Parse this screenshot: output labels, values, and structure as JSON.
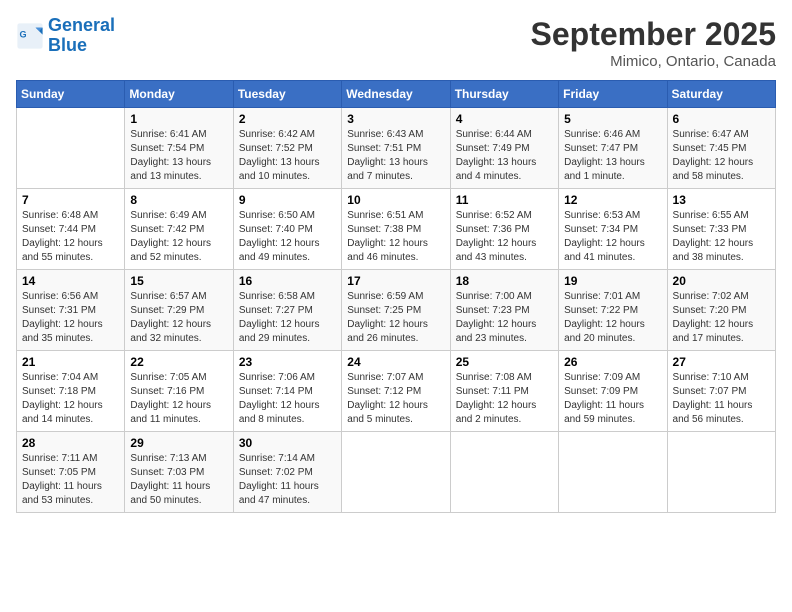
{
  "header": {
    "logo_line1": "General",
    "logo_line2": "Blue",
    "month": "September 2025",
    "location": "Mimico, Ontario, Canada"
  },
  "weekdays": [
    "Sunday",
    "Monday",
    "Tuesday",
    "Wednesday",
    "Thursday",
    "Friday",
    "Saturday"
  ],
  "weeks": [
    [
      {
        "day": "",
        "info": ""
      },
      {
        "day": "1",
        "info": "Sunrise: 6:41 AM\nSunset: 7:54 PM\nDaylight: 13 hours\nand 13 minutes."
      },
      {
        "day": "2",
        "info": "Sunrise: 6:42 AM\nSunset: 7:52 PM\nDaylight: 13 hours\nand 10 minutes."
      },
      {
        "day": "3",
        "info": "Sunrise: 6:43 AM\nSunset: 7:51 PM\nDaylight: 13 hours\nand 7 minutes."
      },
      {
        "day": "4",
        "info": "Sunrise: 6:44 AM\nSunset: 7:49 PM\nDaylight: 13 hours\nand 4 minutes."
      },
      {
        "day": "5",
        "info": "Sunrise: 6:46 AM\nSunset: 7:47 PM\nDaylight: 13 hours\nand 1 minute."
      },
      {
        "day": "6",
        "info": "Sunrise: 6:47 AM\nSunset: 7:45 PM\nDaylight: 12 hours\nand 58 minutes."
      }
    ],
    [
      {
        "day": "7",
        "info": "Sunrise: 6:48 AM\nSunset: 7:44 PM\nDaylight: 12 hours\nand 55 minutes."
      },
      {
        "day": "8",
        "info": "Sunrise: 6:49 AM\nSunset: 7:42 PM\nDaylight: 12 hours\nand 52 minutes."
      },
      {
        "day": "9",
        "info": "Sunrise: 6:50 AM\nSunset: 7:40 PM\nDaylight: 12 hours\nand 49 minutes."
      },
      {
        "day": "10",
        "info": "Sunrise: 6:51 AM\nSunset: 7:38 PM\nDaylight: 12 hours\nand 46 minutes."
      },
      {
        "day": "11",
        "info": "Sunrise: 6:52 AM\nSunset: 7:36 PM\nDaylight: 12 hours\nand 43 minutes."
      },
      {
        "day": "12",
        "info": "Sunrise: 6:53 AM\nSunset: 7:34 PM\nDaylight: 12 hours\nand 41 minutes."
      },
      {
        "day": "13",
        "info": "Sunrise: 6:55 AM\nSunset: 7:33 PM\nDaylight: 12 hours\nand 38 minutes."
      }
    ],
    [
      {
        "day": "14",
        "info": "Sunrise: 6:56 AM\nSunset: 7:31 PM\nDaylight: 12 hours\nand 35 minutes."
      },
      {
        "day": "15",
        "info": "Sunrise: 6:57 AM\nSunset: 7:29 PM\nDaylight: 12 hours\nand 32 minutes."
      },
      {
        "day": "16",
        "info": "Sunrise: 6:58 AM\nSunset: 7:27 PM\nDaylight: 12 hours\nand 29 minutes."
      },
      {
        "day": "17",
        "info": "Sunrise: 6:59 AM\nSunset: 7:25 PM\nDaylight: 12 hours\nand 26 minutes."
      },
      {
        "day": "18",
        "info": "Sunrise: 7:00 AM\nSunset: 7:23 PM\nDaylight: 12 hours\nand 23 minutes."
      },
      {
        "day": "19",
        "info": "Sunrise: 7:01 AM\nSunset: 7:22 PM\nDaylight: 12 hours\nand 20 minutes."
      },
      {
        "day": "20",
        "info": "Sunrise: 7:02 AM\nSunset: 7:20 PM\nDaylight: 12 hours\nand 17 minutes."
      }
    ],
    [
      {
        "day": "21",
        "info": "Sunrise: 7:04 AM\nSunset: 7:18 PM\nDaylight: 12 hours\nand 14 minutes."
      },
      {
        "day": "22",
        "info": "Sunrise: 7:05 AM\nSunset: 7:16 PM\nDaylight: 12 hours\nand 11 minutes."
      },
      {
        "day": "23",
        "info": "Sunrise: 7:06 AM\nSunset: 7:14 PM\nDaylight: 12 hours\nand 8 minutes."
      },
      {
        "day": "24",
        "info": "Sunrise: 7:07 AM\nSunset: 7:12 PM\nDaylight: 12 hours\nand 5 minutes."
      },
      {
        "day": "25",
        "info": "Sunrise: 7:08 AM\nSunset: 7:11 PM\nDaylight: 12 hours\nand 2 minutes."
      },
      {
        "day": "26",
        "info": "Sunrise: 7:09 AM\nSunset: 7:09 PM\nDaylight: 11 hours\nand 59 minutes."
      },
      {
        "day": "27",
        "info": "Sunrise: 7:10 AM\nSunset: 7:07 PM\nDaylight: 11 hours\nand 56 minutes."
      }
    ],
    [
      {
        "day": "28",
        "info": "Sunrise: 7:11 AM\nSunset: 7:05 PM\nDaylight: 11 hours\nand 53 minutes."
      },
      {
        "day": "29",
        "info": "Sunrise: 7:13 AM\nSunset: 7:03 PM\nDaylight: 11 hours\nand 50 minutes."
      },
      {
        "day": "30",
        "info": "Sunrise: 7:14 AM\nSunset: 7:02 PM\nDaylight: 11 hours\nand 47 minutes."
      },
      {
        "day": "",
        "info": ""
      },
      {
        "day": "",
        "info": ""
      },
      {
        "day": "",
        "info": ""
      },
      {
        "day": "",
        "info": ""
      }
    ]
  ]
}
